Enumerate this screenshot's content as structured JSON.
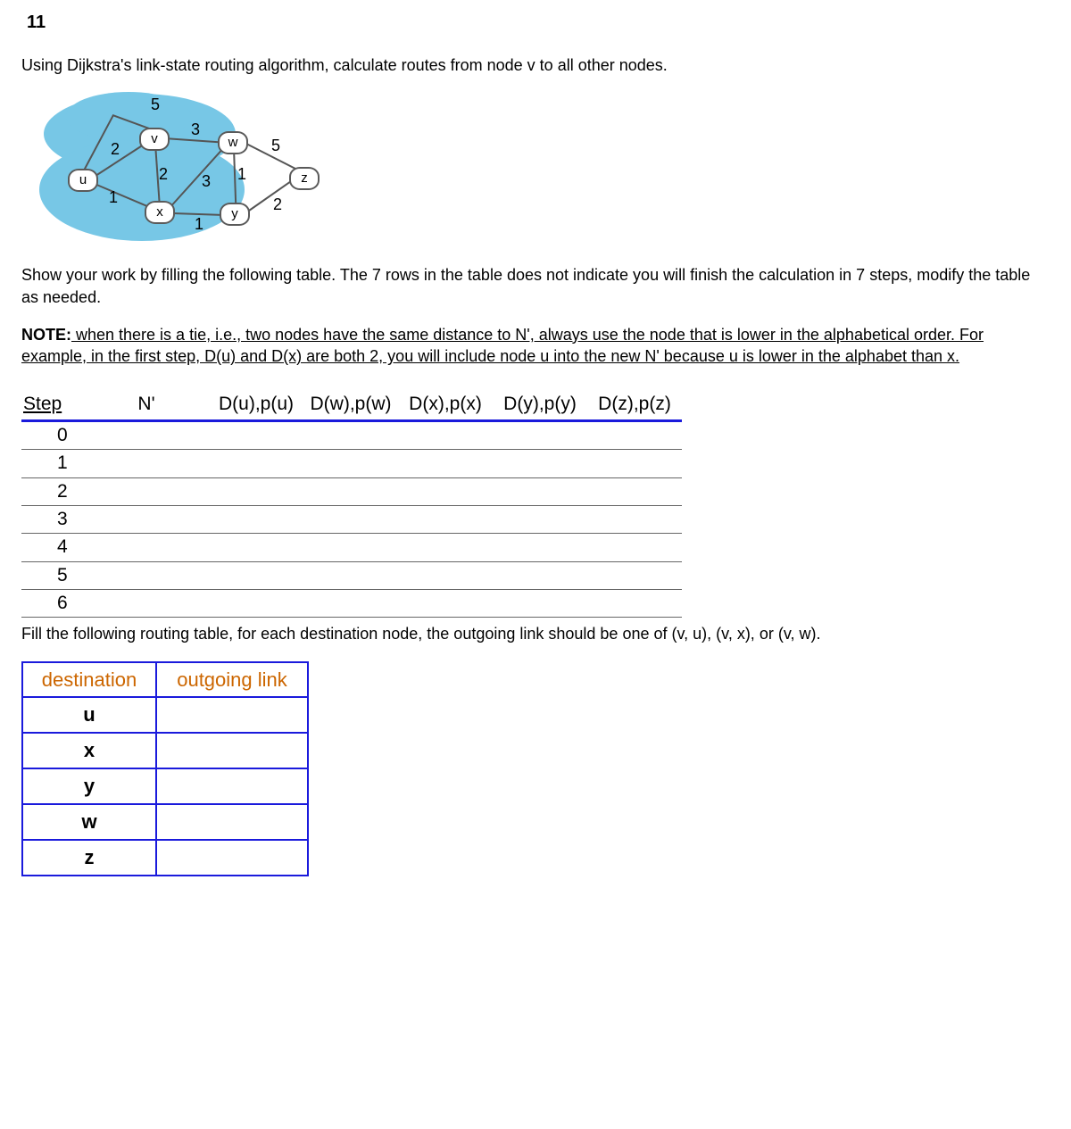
{
  "question_number": "11",
  "prompt": "Using Dijkstra's link-state routing algorithm, calculate routes from node v to all other nodes.",
  "graph": {
    "nodes": [
      "u",
      "v",
      "w",
      "x",
      "y",
      "z"
    ],
    "edge_weights": {
      "u_v_top": "5",
      "u_v": "2",
      "v_w": "3",
      "w_z": "5",
      "v_x": "2",
      "x_w": "3",
      "w_y": "1",
      "u_x": "1",
      "x_y": "1",
      "y_z": "2"
    }
  },
  "instructions_1": "Show your work by filling the following table. The 7 rows in the table does not indicate you will finish the calculation in 7 steps, modify the table as needed.",
  "note_label": "NOTE:",
  "note_text": " when there is a tie, i.e., two nodes have the same distance to N', always use the node that is lower in the alphabetical order. For example, in the first step, D(u) and D(x) are both 2, you will include node u into the new N' because u is lower in the alphabet than x. ",
  "steps_table": {
    "headers": [
      "Step",
      "N'",
      "D(u),p(u)",
      "D(w),p(w)",
      "D(x),p(x)",
      "D(y),p(y)",
      "D(z),p(z)"
    ],
    "rows": [
      "0",
      "1",
      "2",
      "3",
      "4",
      "5",
      "6"
    ]
  },
  "instructions_2": "Fill the following routing table, for each destination node, the outgoing link should be one of (v, u), (v, x), or (v, w).",
  "routing_table": {
    "headers": [
      "destination",
      "outgoing link"
    ],
    "rows": [
      "u",
      "x",
      "y",
      "w",
      "z"
    ]
  }
}
